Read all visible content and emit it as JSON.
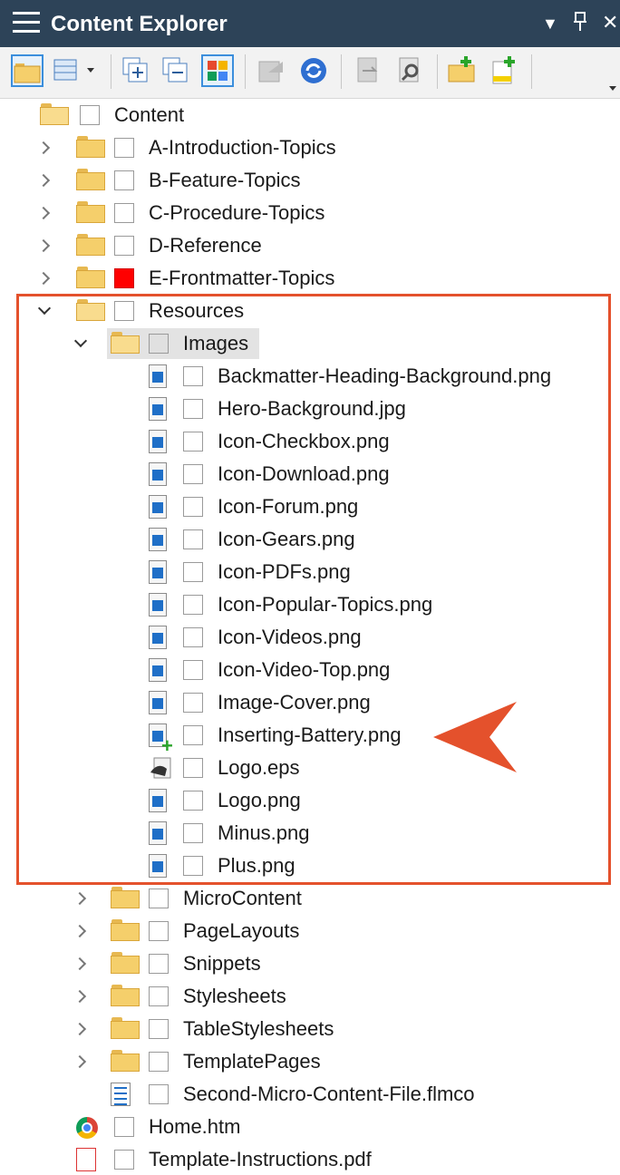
{
  "window": {
    "title": "Content Explorer",
    "dropdown_glyph": "▼",
    "pin_glyph": "₽",
    "close_glyph": "✕"
  },
  "toolbar": {
    "buttons": [
      "open-folder-icon",
      "view-options-icon",
      "expand-all-icon",
      "collapse-all-icon",
      "tile-view-icon",
      "back-icon",
      "refresh-icon",
      "check-out-icon",
      "properties-icon",
      "new-folder-icon",
      "new-file-icon"
    ]
  },
  "tree": {
    "root": "Content",
    "top_folders": [
      "A-Introduction-Topics",
      "B-Feature-Topics",
      "C-Procedure-Topics",
      "D-Reference",
      "E-Frontmatter-Topics"
    ],
    "resources": "Resources",
    "images_folder": "Images",
    "images": [
      "Backmatter-Heading-Background.png",
      "Hero-Background.jpg",
      "Icon-Checkbox.png",
      "Icon-Download.png",
      "Icon-Forum.png",
      "Icon-Gears.png",
      "Icon-PDFs.png",
      "Icon-Popular-Topics.png",
      "Icon-Videos.png",
      "Icon-Video-Top.png",
      "Image-Cover.png",
      "Inserting-Battery.png",
      "Logo.eps",
      "Logo.png",
      "Minus.png",
      "Plus.png"
    ],
    "resource_folders": [
      "MicroContent",
      "PageLayouts",
      "Snippets",
      "Stylesheets",
      "TableStylesheets",
      "TemplatePages"
    ],
    "micro_file": "Second-Micro-Content-File.flmco",
    "home": "Home.htm",
    "cut_off": "Template-Instructions.pdf"
  },
  "colors": {
    "accent": "#e4512c",
    "titlebar": "#2d4358",
    "folder": "#f5cf6b",
    "status_red": "#ff0000"
  }
}
